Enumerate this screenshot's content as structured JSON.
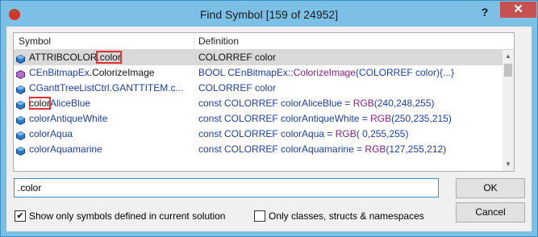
{
  "window": {
    "title": "Find Symbol [159 of 24952]",
    "help": "?",
    "close": "✕"
  },
  "list": {
    "headers": {
      "symbol": "Symbol",
      "definition": "Definition"
    },
    "rows": [
      {
        "icon": "struct-member-icon",
        "sym_parts": [
          [
            "ATTRIBCOLOR",
            "dark",
            0
          ],
          [
            ".color",
            "dark",
            1
          ]
        ],
        "def_parts": [
          [
            "COLORREF color",
            "dark"
          ]
        ]
      },
      {
        "icon": "method-icon",
        "sym_parts": [
          [
            "CEnBitmapEx",
            "blue",
            0
          ],
          [
            ".",
            "dark",
            0
          ],
          [
            "ColorizeImage",
            "dark",
            0
          ]
        ],
        "def_parts": [
          [
            "BOOL CEnBitmapEx::",
            "blue"
          ],
          [
            "ColorizeImage",
            "purple"
          ],
          [
            "(COLORREF color){...}",
            "blue"
          ]
        ]
      },
      {
        "icon": "struct-member-icon",
        "sym_parts": [
          [
            "CGanttTreeListCtrl.GANTTITEM.c...",
            "blue",
            0
          ]
        ],
        "def_parts": [
          [
            "COLORREF color",
            "blue"
          ]
        ]
      },
      {
        "icon": "constant-icon",
        "sym_parts": [
          [
            "color",
            "dark",
            1
          ],
          [
            "AliceBlue",
            "blue",
            0
          ]
        ],
        "def_parts": [
          [
            "const COLORREF colorAliceBlue = ",
            "blue"
          ],
          [
            "RGB",
            "purple"
          ],
          [
            "(240,248,255)",
            "blue"
          ]
        ]
      },
      {
        "icon": "constant-icon",
        "sym_parts": [
          [
            "colorAntiqueWhite",
            "blue",
            0
          ]
        ],
        "def_parts": [
          [
            "const COLORREF colorAntiqueWhite = ",
            "blue"
          ],
          [
            "RGB",
            "purple"
          ],
          [
            "(250,235,215)",
            "blue"
          ]
        ]
      },
      {
        "icon": "constant-icon",
        "sym_parts": [
          [
            "colorAqua",
            "blue",
            0
          ]
        ],
        "def_parts": [
          [
            "const COLORREF colorAqua = ",
            "blue"
          ],
          [
            "RGB",
            "purple"
          ],
          [
            "( 0,255,255)",
            "blue"
          ]
        ]
      },
      {
        "icon": "constant-icon",
        "sym_parts": [
          [
            "colorAquamarine",
            "blue",
            0
          ]
        ],
        "def_parts": [
          [
            "const COLORREF colorAquamarine = ",
            "blue"
          ],
          [
            "RGB",
            "purple"
          ],
          [
            "(127,255,212)",
            "blue"
          ]
        ]
      }
    ],
    "selected_index": 0
  },
  "search": {
    "value": ".color"
  },
  "buttons": {
    "ok": "OK",
    "cancel": "Cancel"
  },
  "options": {
    "current_solution": {
      "label": "Show only symbols defined in current solution",
      "checked": true
    },
    "only_classes": {
      "label": "Only classes, structs & namespaces",
      "checked": false
    }
  },
  "colors": {
    "title_bar": "#7cc0e6",
    "close": "#c75050",
    "highlight": "#e03030",
    "symbol_blue": "#1a3fa8",
    "function_purple": "#8a1c8a"
  }
}
